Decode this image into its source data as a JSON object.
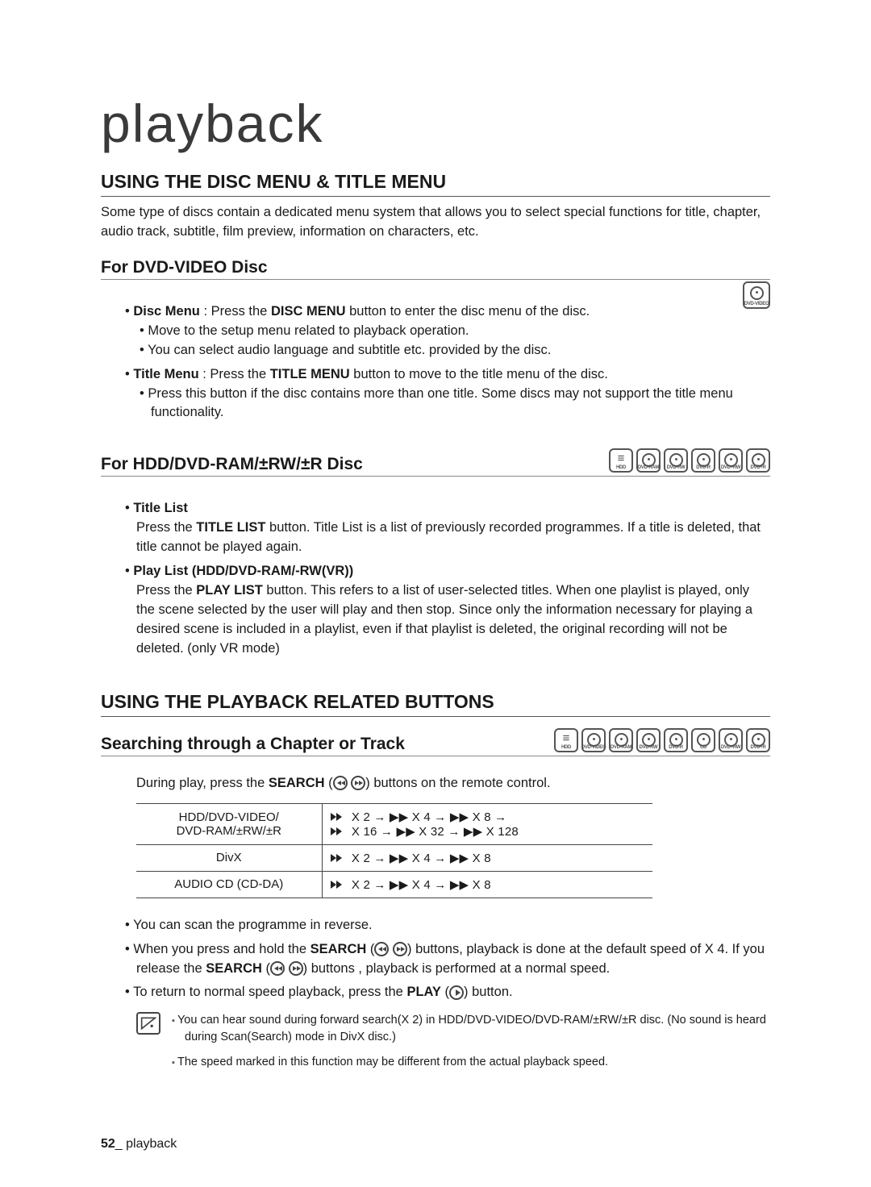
{
  "page": {
    "title": "playback",
    "number": "52",
    "footer_label": "playback"
  },
  "section1": {
    "heading": "USING THE DISC MENU & TITLE MENU",
    "intro": "Some type of discs contain a dedicated menu system that allows you to select special functions for title, chapter, audio track, subtitle, film preview, information on characters, etc.",
    "sub1": {
      "heading": "For DVD-VIDEO Disc",
      "icons": [
        "DVD-VIDEO"
      ],
      "items": {
        "disc_menu_lead": "Disc Menu",
        "disc_menu_text": " : Press the ",
        "disc_menu_btn": "DISC MENU",
        "disc_menu_tail": " button to enter the disc menu of the disc.",
        "disc_menu_sub1": "Move to the setup menu related to playback operation.",
        "disc_menu_sub2": "You can select audio language and subtitle etc. provided by the disc.",
        "title_menu_lead": "Title Menu",
        "title_menu_text": " : Press the ",
        "title_menu_btn": "TITLE MENU",
        "title_menu_tail": " button to move to the title menu of the disc.",
        "title_menu_sub1": "Press this button if the disc contains more than one title. Some discs may not support the title menu functionality."
      }
    },
    "sub2": {
      "heading": "For HDD/DVD-RAM/±RW/±R Disc",
      "icons": [
        "HDD",
        "DVD-RAM",
        "DVD-RW",
        "DVD-R",
        "DVD+RW",
        "DVD+R"
      ],
      "items": {
        "title_list_lead": "Title List",
        "title_list_text1": "Press the ",
        "title_list_btn": "TITLE LIST",
        "title_list_text2": " button. Title List is a list of previously recorded programmes. If a title is deleted, that title cannot be played again.",
        "play_list_lead": "Play List (HDD/DVD-RAM/-RW(VR))",
        "play_list_text1": "Press the ",
        "play_list_btn": "PLAY LIST",
        "play_list_text2": " button. This refers to a list of user-selected titles. When one playlist is played, only the scene selected by the user will play and then stop. Since only the information necessary for playing a desired scene is included in a playlist, even if that playlist is deleted, the original recording will not be deleted. (only VR mode)"
      }
    }
  },
  "section2": {
    "heading": "USING THE PLAYBACK RELATED BUTTONS",
    "sub1": {
      "heading": "Searching through a Chapter or Track",
      "icons": [
        "HDD",
        "DVD-VIDEO",
        "DVD-RAM",
        "DVD-RW",
        "DVD-R",
        "CD",
        "DVD+RW",
        "DVD+R"
      ],
      "lead_text1": "During play, press the ",
      "lead_bold": "SEARCH",
      "lead_text2": " buttons on the remote control.",
      "table": [
        {
          "label_line1": "HDD/DVD-VIDEO/",
          "label_line2": "DVD-RAM/±RW/±R",
          "seq1": "X 2 → ▶▶ X 4 → ▶▶ X 8 →",
          "seq2": "X 16 → ▶▶ X 32 → ▶▶ X 128"
        },
        {
          "label_line1": "DivX",
          "seq1": "X 2 → ▶▶ X 4 → ▶▶ X 8"
        },
        {
          "label_line1": "AUDIO CD (CD-DA)",
          "seq1": "X 2 → ▶▶ X 4 → ▶▶ X 8"
        }
      ],
      "after": {
        "b1": "You can scan the programme in reverse.",
        "b2a": "When you press and hold the ",
        "b2bold1": "SEARCH",
        "b2b": " buttons, playback is done at the default speed of X 4. If you release the ",
        "b2bold2": "SEARCH",
        "b2c": " buttons , playback is performed at a normal speed.",
        "b3a": "To return to normal speed playback, press the ",
        "b3bold": "PLAY",
        "b3b": " button."
      },
      "notes": {
        "n1": "You can hear sound during forward search(X 2) in HDD/DVD-VIDEO/DVD-RAM/±RW/±R disc. (No sound is heard during Scan(Search) mode in DivX disc.)",
        "n2": "The speed marked in this function may be different from the actual playback speed."
      }
    }
  }
}
